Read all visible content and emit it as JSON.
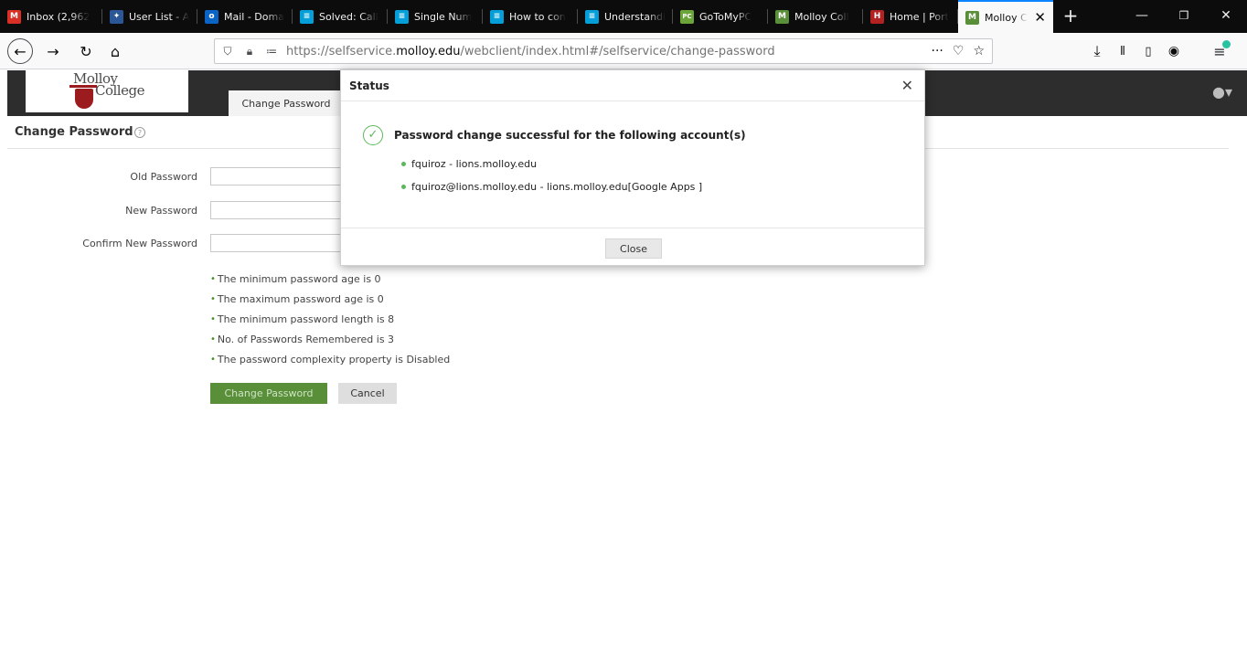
{
  "tabs": [
    {
      "title": "Inbox (2,962",
      "icon": "gmail-icon",
      "color": "#d93025",
      "glyph": "M"
    },
    {
      "title": "User List - A",
      "icon": "shield-icon",
      "color": "#2b5797",
      "glyph": "✦"
    },
    {
      "title": "Mail - Doma",
      "icon": "outlook-icon",
      "color": "#0a64c6",
      "glyph": "o"
    },
    {
      "title": "Solved: Call",
      "icon": "cisco-icon",
      "color": "#049fd9",
      "glyph": "≡"
    },
    {
      "title": "Single Num",
      "icon": "cisco-icon",
      "color": "#049fd9",
      "glyph": "≡"
    },
    {
      "title": "How to con",
      "icon": "cisco-icon",
      "color": "#049fd9",
      "glyph": "≡"
    },
    {
      "title": "Understandi",
      "icon": "cisco-icon",
      "color": "#049fd9",
      "glyph": "≡"
    },
    {
      "title": "GoToMyPC",
      "icon": "gotomypc-icon",
      "color": "#6ba539",
      "glyph": "PC"
    },
    {
      "title": "Molloy Coll",
      "icon": "molloy-icon",
      "color": "#5a8f3a",
      "glyph": "M"
    },
    {
      "title": "Home | Port",
      "icon": "portal-icon",
      "color": "#b22222",
      "glyph": "H"
    },
    {
      "title": "Molloy C",
      "icon": "molloy-icon",
      "color": "#5a8f3a",
      "glyph": "M"
    }
  ],
  "browser": {
    "url_prefix": "https://selfservice.",
    "url_domain": "molloy.edu",
    "url_path": "/webclient/index.html#/selfservice/change-password"
  },
  "app": {
    "logo_line1": "Molloy",
    "logo_line2": "College",
    "header_tab": "Change Password"
  },
  "form": {
    "title": "Change Password",
    "old_password_label": "Old Password",
    "new_password_label": "New Password",
    "confirm_password_label": "Confirm New Password",
    "rules": [
      "The minimum password age is 0",
      "The maximum password age is 0",
      "The minimum password length is 8",
      "No. of Passwords Remembered is 3",
      "The password complexity property is Disabled"
    ],
    "change_button": "Change Password",
    "cancel_button": "Cancel"
  },
  "modal": {
    "title": "Status",
    "message": "Password change successful for the following account(s)",
    "accounts": [
      "fquiroz - lions.molloy.edu",
      "fquiroz@lions.molloy.edu - lions.molloy.edu[Google Apps ]"
    ],
    "close_button": "Close"
  }
}
